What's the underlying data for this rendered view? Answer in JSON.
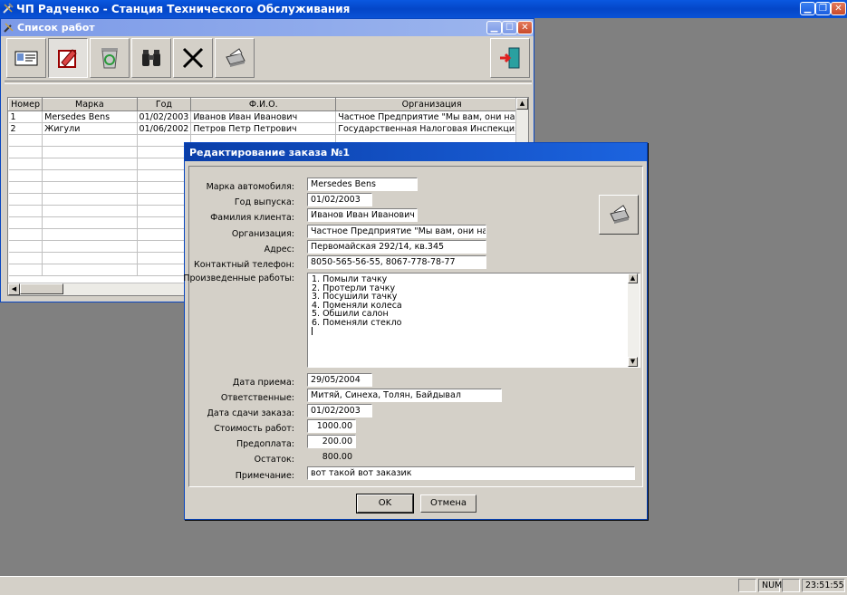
{
  "app": {
    "title": "ЧП Радченко - Станция Технического Обслуживания"
  },
  "list_window": {
    "title": "Список работ",
    "toolbar": [
      "card-icon",
      "edit-icon",
      "recycle-icon",
      "binoculars-icon",
      "delete-x-icon",
      "printer-icon",
      "exit-door-icon"
    ],
    "columns": [
      "Номер",
      "Марка",
      "Год",
      "Ф.И.О.",
      "Организация"
    ],
    "rows": [
      [
        "1",
        "Mersedes Bens",
        "01/02/2003",
        "Иванов Иван Иванович",
        "Частное Предприятие \"Мы вам, они нам\""
      ],
      [
        "2",
        "Жигули",
        "01/06/2002",
        "Петров Петр Петрович",
        "Государственная Налоговая Инспекция"
      ]
    ]
  },
  "dialog": {
    "title": "Редактирование заказа №1",
    "fields": {
      "brand": {
        "label": "Марка автомобиля:",
        "value": "Mersedes Bens"
      },
      "year": {
        "label": "Год выпуска:",
        "value": "01/02/2003"
      },
      "client": {
        "label": "Фамилия клиента:",
        "value": "Иванов Иван Иванович"
      },
      "org": {
        "label": "Организация:",
        "value": "Частное Предприятие \"Мы вам, они нам\""
      },
      "address": {
        "label": "Адрес:",
        "value": "Первомайская 292/14, кв.345"
      },
      "phone": {
        "label": "Контактный телефон:",
        "value": "8050-565-56-55, 8067-778-78-77"
      },
      "works": {
        "label": "Произведенные работы:",
        "lines": [
          "1. Помыли тачку",
          "2. Протерли тачку",
          "3. Посушили тачку",
          "4. Поменяли колеса",
          "5. Обшили салон",
          "6. Поменяли стекло"
        ]
      },
      "received": {
        "label": "Дата приема:",
        "value": "29/05/2004"
      },
      "responsible": {
        "label": "Ответственные:",
        "value": "Митяй, Синеха, Толян, Байдывал"
      },
      "delivery": {
        "label": "Дата сдачи заказа:",
        "value": "01/02/2003"
      },
      "cost": {
        "label": "Стоимость работ:",
        "value": "1000.00"
      },
      "prepay": {
        "label": "Предоплата:",
        "value": "200.00"
      },
      "rest": {
        "label": "Остаток:",
        "value": "800.00"
      },
      "note": {
        "label": "Примечание:",
        "value": "вот такой вот заказик"
      }
    },
    "ok_label": "OK",
    "cancel_label": "Отмена"
  },
  "status_bar": {
    "num": "NUM",
    "time": "23:51:55"
  }
}
